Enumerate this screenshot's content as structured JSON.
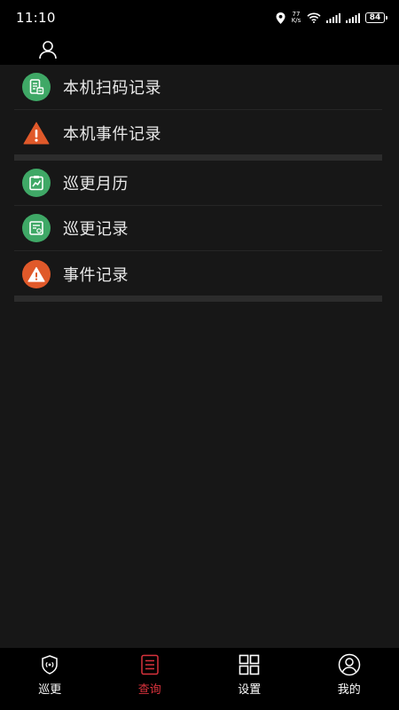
{
  "status_bar": {
    "time": "11:10",
    "net_speed_value": "77",
    "net_speed_unit": "K/s",
    "battery": "84"
  },
  "top_bar": {
    "icon": "user-icon"
  },
  "groups": [
    {
      "items": [
        {
          "label": "本机扫码记录",
          "icon": "scan-record-icon",
          "color": "#3fa866"
        },
        {
          "label": "本机事件记录",
          "icon": "warning-triangle-icon",
          "color": "#e0592a"
        }
      ]
    },
    {
      "items": [
        {
          "label": "巡更月历",
          "icon": "calendar-chart-icon",
          "color": "#3fa866"
        },
        {
          "label": "巡更记录",
          "icon": "record-list-icon",
          "color": "#3fa866"
        },
        {
          "label": "事件记录",
          "icon": "warning-circle-icon",
          "color": "#e0592a"
        }
      ]
    }
  ],
  "bottom_nav": {
    "items": [
      {
        "label": "巡更",
        "icon": "patrol-shield-icon",
        "active": false
      },
      {
        "label": "查询",
        "icon": "list-icon",
        "active": true
      },
      {
        "label": "设置",
        "icon": "grid-icon",
        "active": false
      },
      {
        "label": "我的",
        "icon": "profile-icon",
        "active": false
      }
    ],
    "active_color": "#d8323c"
  }
}
